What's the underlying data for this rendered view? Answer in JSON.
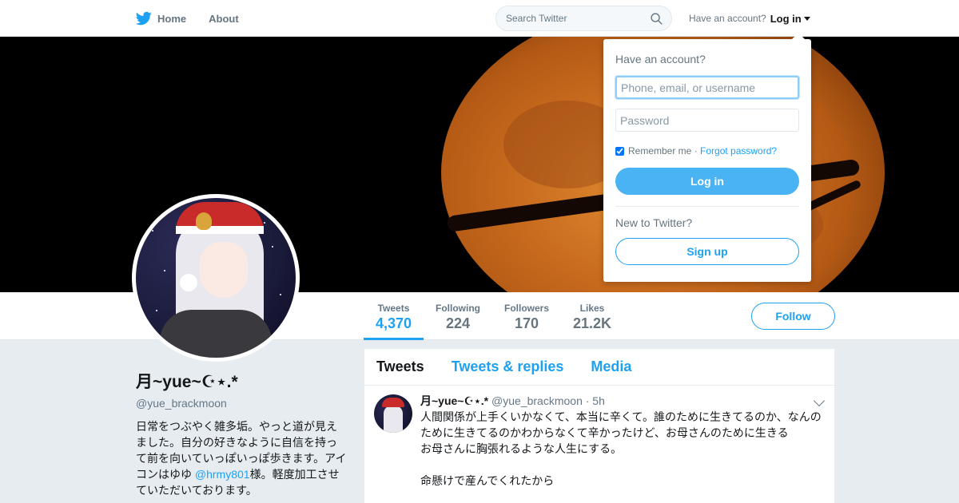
{
  "nav": {
    "home_label": "Home",
    "about_label": "About",
    "search_placeholder": "Search Twitter",
    "have_account_text": "Have an account?",
    "login_label": "Log in"
  },
  "profile": {
    "display_name": "月~yue~☪︎⋆.*",
    "handle": "@yue_brackmoon",
    "bio_before_mention": "日常をつぶやく雑多垢。やっと道が見えました。自分の好きなように自信を持って前を向いていっぽいっぽ歩きます。アイコンはゆゆ ",
    "bio_mention": "@hrmy801",
    "bio_after_mention": "様。軽度加工させていただいております。",
    "follow_label": "Follow"
  },
  "stats": [
    {
      "label": "Tweets",
      "value": "4,370"
    },
    {
      "label": "Following",
      "value": "224"
    },
    {
      "label": "Followers",
      "value": "170"
    },
    {
      "label": "Likes",
      "value": "21.2K"
    }
  ],
  "timeline": {
    "tabs": [
      {
        "label": "Tweets"
      },
      {
        "label": "Tweets & replies"
      },
      {
        "label": "Media"
      }
    ],
    "tweet": {
      "name": "月~yue~☪︎⋆.*",
      "handle": "@yue_brackmoon",
      "time": "· 5h",
      "text": "人間関係が上手くいかなくて、本当に辛くて。誰のために生きてるのか、なんのために生きてるのかわからなくて辛かったけど、お母さんのために生きる\nお母さんに胸張れるような人生にする。\n\n命懸けで産んでくれたから"
    }
  },
  "login_dropdown": {
    "heading": "Have an account?",
    "username_placeholder": "Phone, email, or username",
    "password_placeholder": "Password",
    "remember_label": "Remember me",
    "separator": " · ",
    "forgot_label": "Forgot password?",
    "login_button": "Log in",
    "new_text": "New to Twitter?",
    "signup_button": "Sign up"
  },
  "colors": {
    "accent": "#1da1f2",
    "background": "#e6ecf0",
    "text": "#14171a",
    "muted": "#657786"
  }
}
